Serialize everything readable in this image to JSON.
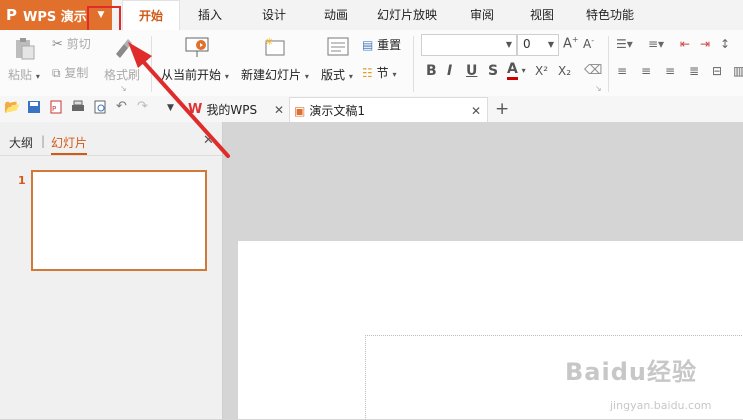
{
  "app": {
    "name": "WPS 演示",
    "logo_glyph": "P"
  },
  "menu_tabs": [
    "开始",
    "插入",
    "设计",
    "动画",
    "幻灯片放映",
    "审阅",
    "视图",
    "特色功能"
  ],
  "ribbon": {
    "paste": "粘贴",
    "cut": "剪切",
    "copy": "复制",
    "format_painter": "格式刷",
    "from_current": "从当前开始",
    "new_slide": "新建幻灯片",
    "layout": "版式",
    "reset": "重置",
    "section": "节",
    "font_size": "0",
    "bold": "B",
    "italic": "I",
    "underline": "U",
    "strike": "S",
    "font_color": "A",
    "superscript": "X²",
    "subscript": "X₂"
  },
  "doc_tabs": [
    {
      "label": "我的WPS"
    },
    {
      "label": "演示文稿1"
    }
  ],
  "panel": {
    "outline_tab": "大纲",
    "separator": "|",
    "slides_tab": "幻灯片",
    "slide_number": "1"
  },
  "watermark": {
    "brand": "Baidu经验",
    "url": "jingyan.baidu.com"
  },
  "colors": {
    "accent": "#e0702b",
    "annotation": "#e02b2b"
  }
}
